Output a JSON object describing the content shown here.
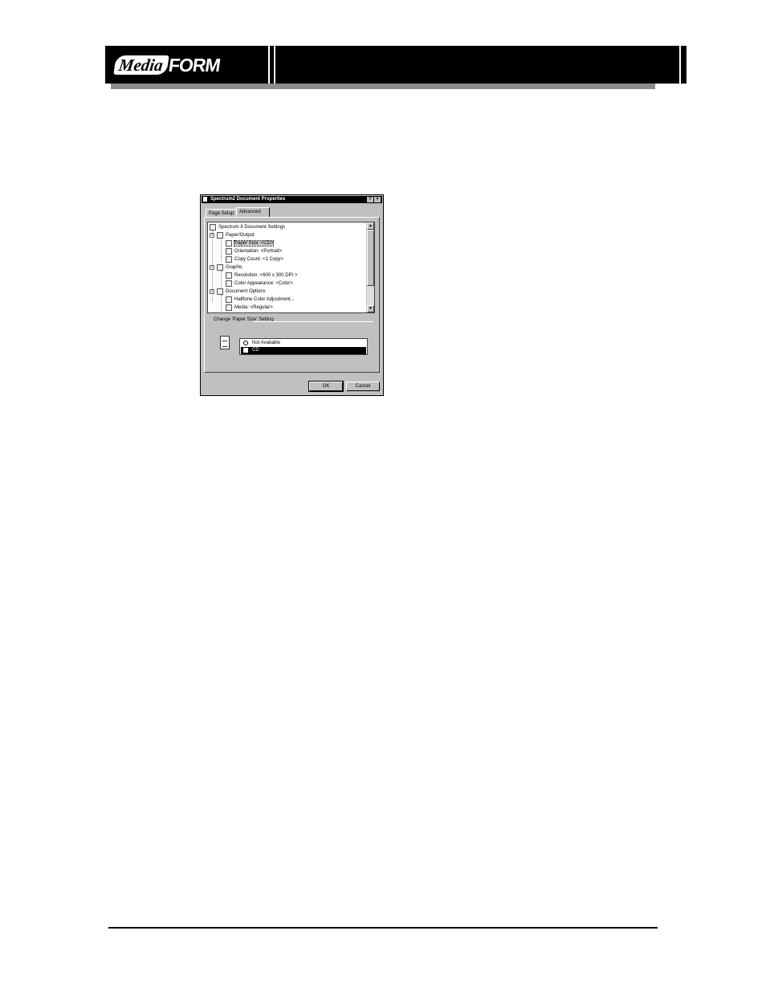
{
  "header": {
    "logo_media": "Media",
    "logo_form": "FORM"
  },
  "dialog": {
    "title": "Spectrum2 Document Properties",
    "help_button": "?",
    "close_button": "×",
    "tabs": [
      {
        "label": "Page Setup"
      },
      {
        "label": "Advanced"
      }
    ],
    "tree": [
      {
        "label": "Spectrum II Document Settings",
        "icon": "printer-icon",
        "expander": ""
      },
      {
        "label": "Paper/Output",
        "icon": "folder-icon",
        "expander": "−"
      },
      {
        "label": "Paper Size: <CD>",
        "icon": "document-icon",
        "expander": ""
      },
      {
        "label": "Orientation: <Portrait>",
        "icon": "document-icon",
        "expander": ""
      },
      {
        "label": "Copy Count: <1 Copy>",
        "icon": "document-icon",
        "expander": ""
      },
      {
        "label": "Graphic",
        "icon": "folder-icon",
        "expander": "−"
      },
      {
        "label": "Resolution: <600 x 300 DPI >",
        "icon": "grid-icon",
        "expander": ""
      },
      {
        "label": "Color Appearance: <Color>",
        "icon": "palette-icon",
        "expander": ""
      },
      {
        "label": "Document Options",
        "icon": "folder-icon",
        "expander": "−"
      },
      {
        "label": "Halftone Color Adjustment...",
        "icon": "halftone-icon",
        "expander": ""
      },
      {
        "label": "Media: <Regular>",
        "icon": "document-icon",
        "expander": ""
      }
    ],
    "change_label": "Change 'Paper Size' Setting",
    "list_items": [
      {
        "label": "Not Available"
      },
      {
        "label": "CD"
      }
    ],
    "ok_label": "OK",
    "cancel_label": "Cancel"
  }
}
